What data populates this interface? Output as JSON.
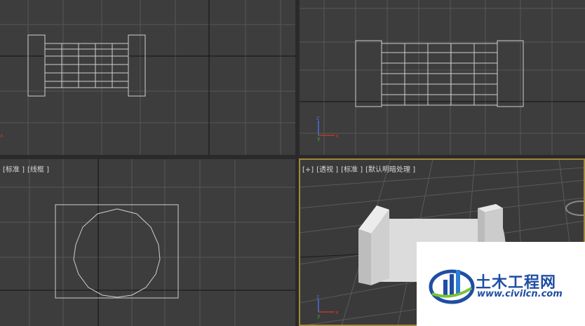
{
  "viewports": {
    "top": {
      "labels": []
    },
    "front": {
      "labels": []
    },
    "left": {
      "labels": [
        "[标准 ]",
        "[线框 ]"
      ]
    },
    "perspective": {
      "labels": [
        "[+]",
        "[透视 ]",
        "[标准 ]",
        "[默认明暗处理 ]"
      ]
    }
  },
  "gizmo": {
    "z": "z",
    "y": "y",
    "x": "x"
  },
  "watermark": {
    "title": "土木工程网",
    "url": "www.civilcn.com"
  },
  "colors": {
    "viewport_bg": "#3d3d3d",
    "grid": "#555555",
    "axis": "#111111",
    "wire": "#d0d0d0",
    "active": "#a08a3c",
    "brand": "#1f4ea3"
  }
}
